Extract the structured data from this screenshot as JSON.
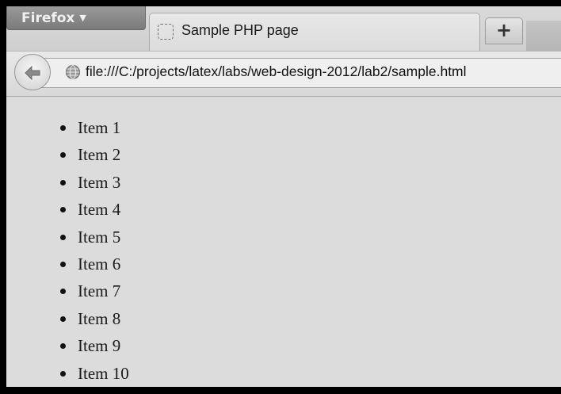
{
  "browser": {
    "menu_button": {
      "label": "Firefox",
      "icon": "caret-down-icon"
    },
    "tab": {
      "title": "Sample PHP page",
      "favicon": "blank-page-icon"
    },
    "new_tab": {
      "label": "+"
    }
  },
  "navbar": {
    "back_icon": "back-arrow-icon",
    "site_icon": "globe-icon",
    "url": "file:///C:/projects/latex/labs/web-design-2012/lab2/sample.html"
  },
  "page": {
    "items": [
      "Item 1",
      "Item 2",
      "Item 3",
      "Item 4",
      "Item 5",
      "Item 6",
      "Item 7",
      "Item 8",
      "Item 9",
      "Item 10"
    ]
  }
}
